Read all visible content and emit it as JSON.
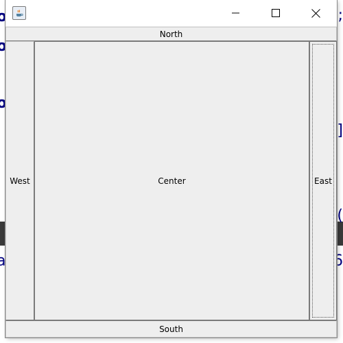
{
  "window": {
    "title": "",
    "controls": {
      "minimize_icon": "minimize-icon",
      "maximize_icon": "maximize-icon",
      "close_icon": "close-icon"
    }
  },
  "layout_buttons": {
    "north": "North",
    "west": "West",
    "center": "Center",
    "east": "East",
    "south": "South"
  },
  "background_fragments": {
    "left": [
      "o",
      "o",
      "o",
      "a"
    ],
    "right": [
      ";",
      "]",
      "(",
      "6"
    ]
  },
  "colors": {
    "code_text": "#000080",
    "window_bg": "#f0f0f0",
    "button_bg": "#eeeeee"
  }
}
